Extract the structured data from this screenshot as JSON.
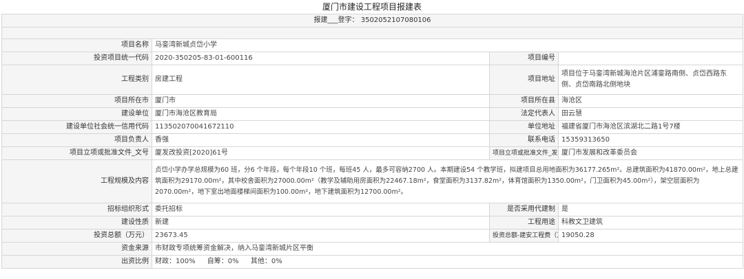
{
  "title": "厦门市建设工程项目报建表",
  "registration": {
    "label": "报建___登字",
    "number": "3502052107080106"
  },
  "fields": {
    "project_name": {
      "label": "项目名称",
      "value": "马銮湾新城贞岱小学"
    },
    "project_code": {
      "label": "投资项目统一代码",
      "value": "2020-350205-83-01-600116"
    },
    "project_number": {
      "label": "项目编号",
      "value": ""
    },
    "project_type": {
      "label": "工程类别",
      "value": "房建工程"
    },
    "project_address": {
      "label": "项目地址",
      "value": "项目位于马銮湾新城海沧片区浦銮路南侧、贞岱西路东侧、贞岱南路北侧地块"
    },
    "city": {
      "label": "项目所在市",
      "value": "厦门市"
    },
    "county": {
      "label": "项目所在县",
      "value": "海沧区"
    },
    "builder": {
      "label": "建设单位",
      "value": "厦门市海沧区教育局"
    },
    "legal_rep": {
      "label": "法定代表人",
      "value": "田云慧"
    },
    "credit_code": {
      "label": "建设单位社会统一信用代码",
      "value": "113502070041672110"
    },
    "unit_address": {
      "label": "单位地址",
      "value": "福建省厦门市海沧区滨湖北二路1号7楼"
    },
    "manager": {
      "label": "项目负责人",
      "value": "香强"
    },
    "phone": {
      "label": "联系电话",
      "value": "15359313650"
    },
    "approval_doc": {
      "label": "项目立项或批准文件_文号",
      "value": "厦发改投资[2020]61号"
    },
    "approval_unit": {
      "label": "项目立项或批准文件_发文单位",
      "value": "厦门市发展和改革委员会"
    },
    "scale": {
      "label": "工程规模及内容",
      "value": "贞岱小学办学总规模为60 班，分6 个年段，每个年段10 个班，每班45 人，最多可容纳2700 人。本期建设54 个教学班，拟建项目总用地面积为36177.265m²。总建筑面积为41870.00m²，地上总建筑面积为29170.00m²，其中校舍面积为27000.00m²（教学及辅助用房面积为22467.18m²，食堂面积为3137.82m²，体育馆面积为1350.00m²，门卫面积为45.00m²），架空层面积为2070.00m²，地下室出地面楼梯间面积为100.00m²，地下建筑面积为12700.00m²。"
    },
    "bid_form": {
      "label": "招标组织形式",
      "value": "委托招标"
    },
    "agent_system": {
      "label": "是否采用代建制",
      "value": "是"
    },
    "build_nature": {
      "label": "建设性质",
      "value": "新建"
    },
    "usage": {
      "label": "工程用途",
      "value": "科教文卫建筑"
    },
    "total_invest": {
      "label": "投资总额（万元）",
      "value": "23673.45"
    },
    "install_invest": {
      "label": "投资总额-建安工程费（万元）",
      "value": "19050.28"
    },
    "fund_source": {
      "label": "资金来源",
      "value": "市财政专项统筹资金解决，纳入马銮湾新城片区平衡"
    },
    "ratio": {
      "label": "出资比例",
      "finance_label": "财政：",
      "finance_value": "100%",
      "self_label": "自筹：",
      "self_value": "0%",
      "other_label": "其他：",
      "other_value": "0%"
    }
  }
}
